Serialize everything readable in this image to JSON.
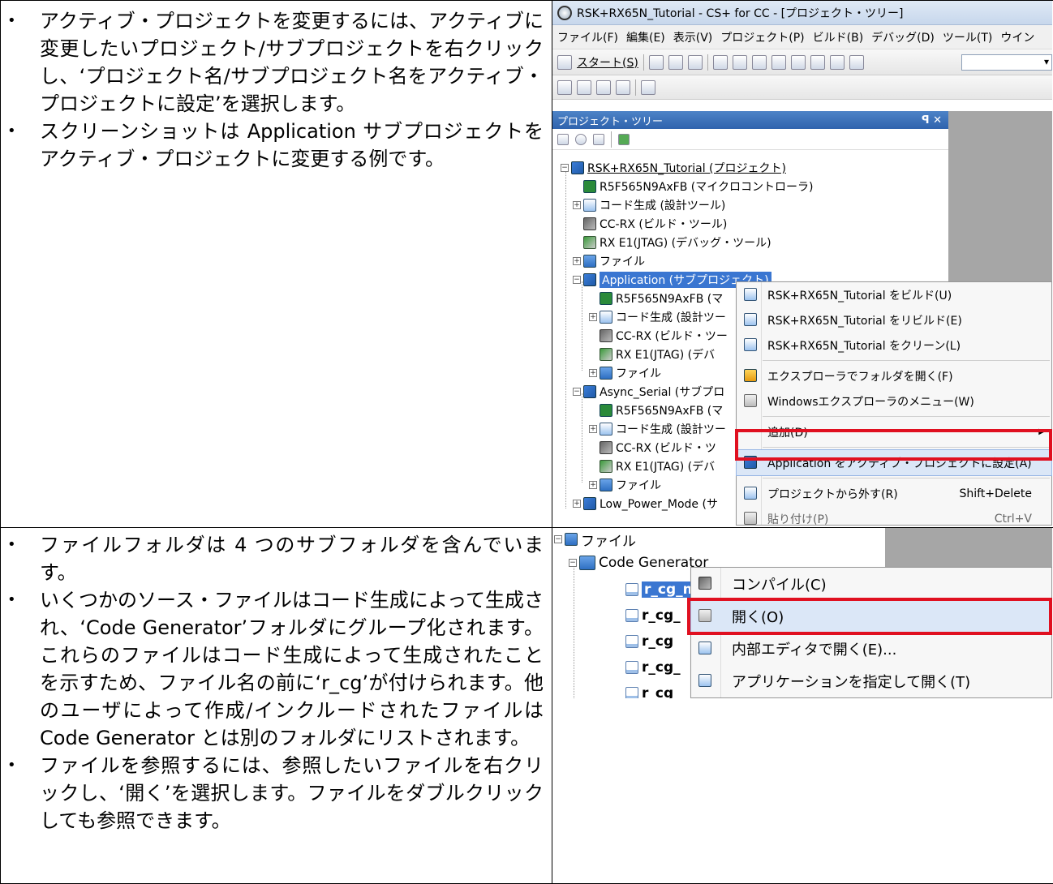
{
  "row1": {
    "bullets": [
      "アクティブ・プロジェクトを変更するには、アクティブに変更したいプロジェクト/サブプロジェクトを右クリックし、‘プロジェクト名/サブプロジェクト名をアクティブ・プロジェクトに設定’を選択します。",
      "スクリーンショットは Application サブプロジェクトをアクティブ・プロジェクトに変更する例です。"
    ],
    "window": {
      "title": "RSK+RX65N_Tutorial - CS+ for CC - [プロジェクト・ツリー]",
      "menu": [
        "ファイル(F)",
        "編集(E)",
        "表示(V)",
        "プロジェクト(P)",
        "ビルド(B)",
        "デバッグ(D)",
        "ツール(T)",
        "ウイン"
      ],
      "start_button": "スタート(S)",
      "panel_title": "プロジェクト・ツリー",
      "panel_pin": "ꟼ ✕",
      "tree": [
        "RSK+RX65N_Tutorial (プロジェクト)",
        "R5F565N9AxFB (マイクロコントローラ)",
        "コード生成 (設計ツール)",
        "CC-RX (ビルド・ツール)",
        "RX E1(JTAG) (デバッグ・ツール)",
        "ファイル",
        "Application (サブプロジェクト)",
        "R5F565N9AxFB (マ",
        "コード生成 (設計ツー",
        "CC-RX (ビルド・ツー",
        "RX E1(JTAG) (デバ",
        "ファイル",
        "Async_Serial (サブプロ",
        "R5F565N9AxFB (マ",
        "コード生成 (設計ツー",
        "CC-RX (ビルド・ツ",
        "RX E1(JTAG) (デバ",
        "ファイル",
        "Low_Power_Mode (サ"
      ],
      "context_menu": [
        {
          "label": "RSK+RX65N_Tutorial をビルド(U)",
          "shortcut": ""
        },
        {
          "label": "RSK+RX65N_Tutorial をリビルド(E)",
          "shortcut": ""
        },
        {
          "label": "RSK+RX65N_Tutorial をクリーン(L)",
          "shortcut": ""
        },
        {
          "label": "エクスプローラでフォルダを開く(F)",
          "shortcut": ""
        },
        {
          "label": "Windowsエクスプローラのメニュー(W)",
          "shortcut": ""
        },
        {
          "label": "追加(D)",
          "shortcut": ""
        },
        {
          "label": "Application をアクティブ・プロジェクトに設定(A)",
          "shortcut": ""
        },
        {
          "label": "プロジェクトから外す(R)",
          "shortcut": "Shift+Delete"
        },
        {
          "label": "貼り付け(P)",
          "shortcut": "Ctrl+V"
        }
      ]
    }
  },
  "row2": {
    "bullets": [
      "ファイルフォルダは 4 つのサブフォルダを含んでいます。",
      "いくつかのソース・ファイルはコード生成によって生成され、‘Code Generator’フォルダにグループ化されます。これらのファイルはコード生成によって生成されたことを示すため、ファイル名の前に‘r_cg’が付けられます。他のユーザによって作成/インクルードされたファイルは Code Generator とは別のフォルダにリストされます。",
      "ファイルを参照するには、参照したいファイルを右クリックし、‘開く’を選択します。ファイルをダブルクリックしても参照できます。"
    ],
    "tree": [
      "ファイル",
      "Code Generator",
      "r_cg_main.c",
      "r_cg_",
      "r_cg",
      "r_cg_",
      "r_cg_"
    ],
    "context_menu": [
      {
        "label": "コンパイル(C)"
      },
      {
        "label": "開く(O)"
      },
      {
        "label": "内部エディタで開く(E)..."
      },
      {
        "label": "アプリケーションを指定して開く(T)"
      }
    ]
  }
}
